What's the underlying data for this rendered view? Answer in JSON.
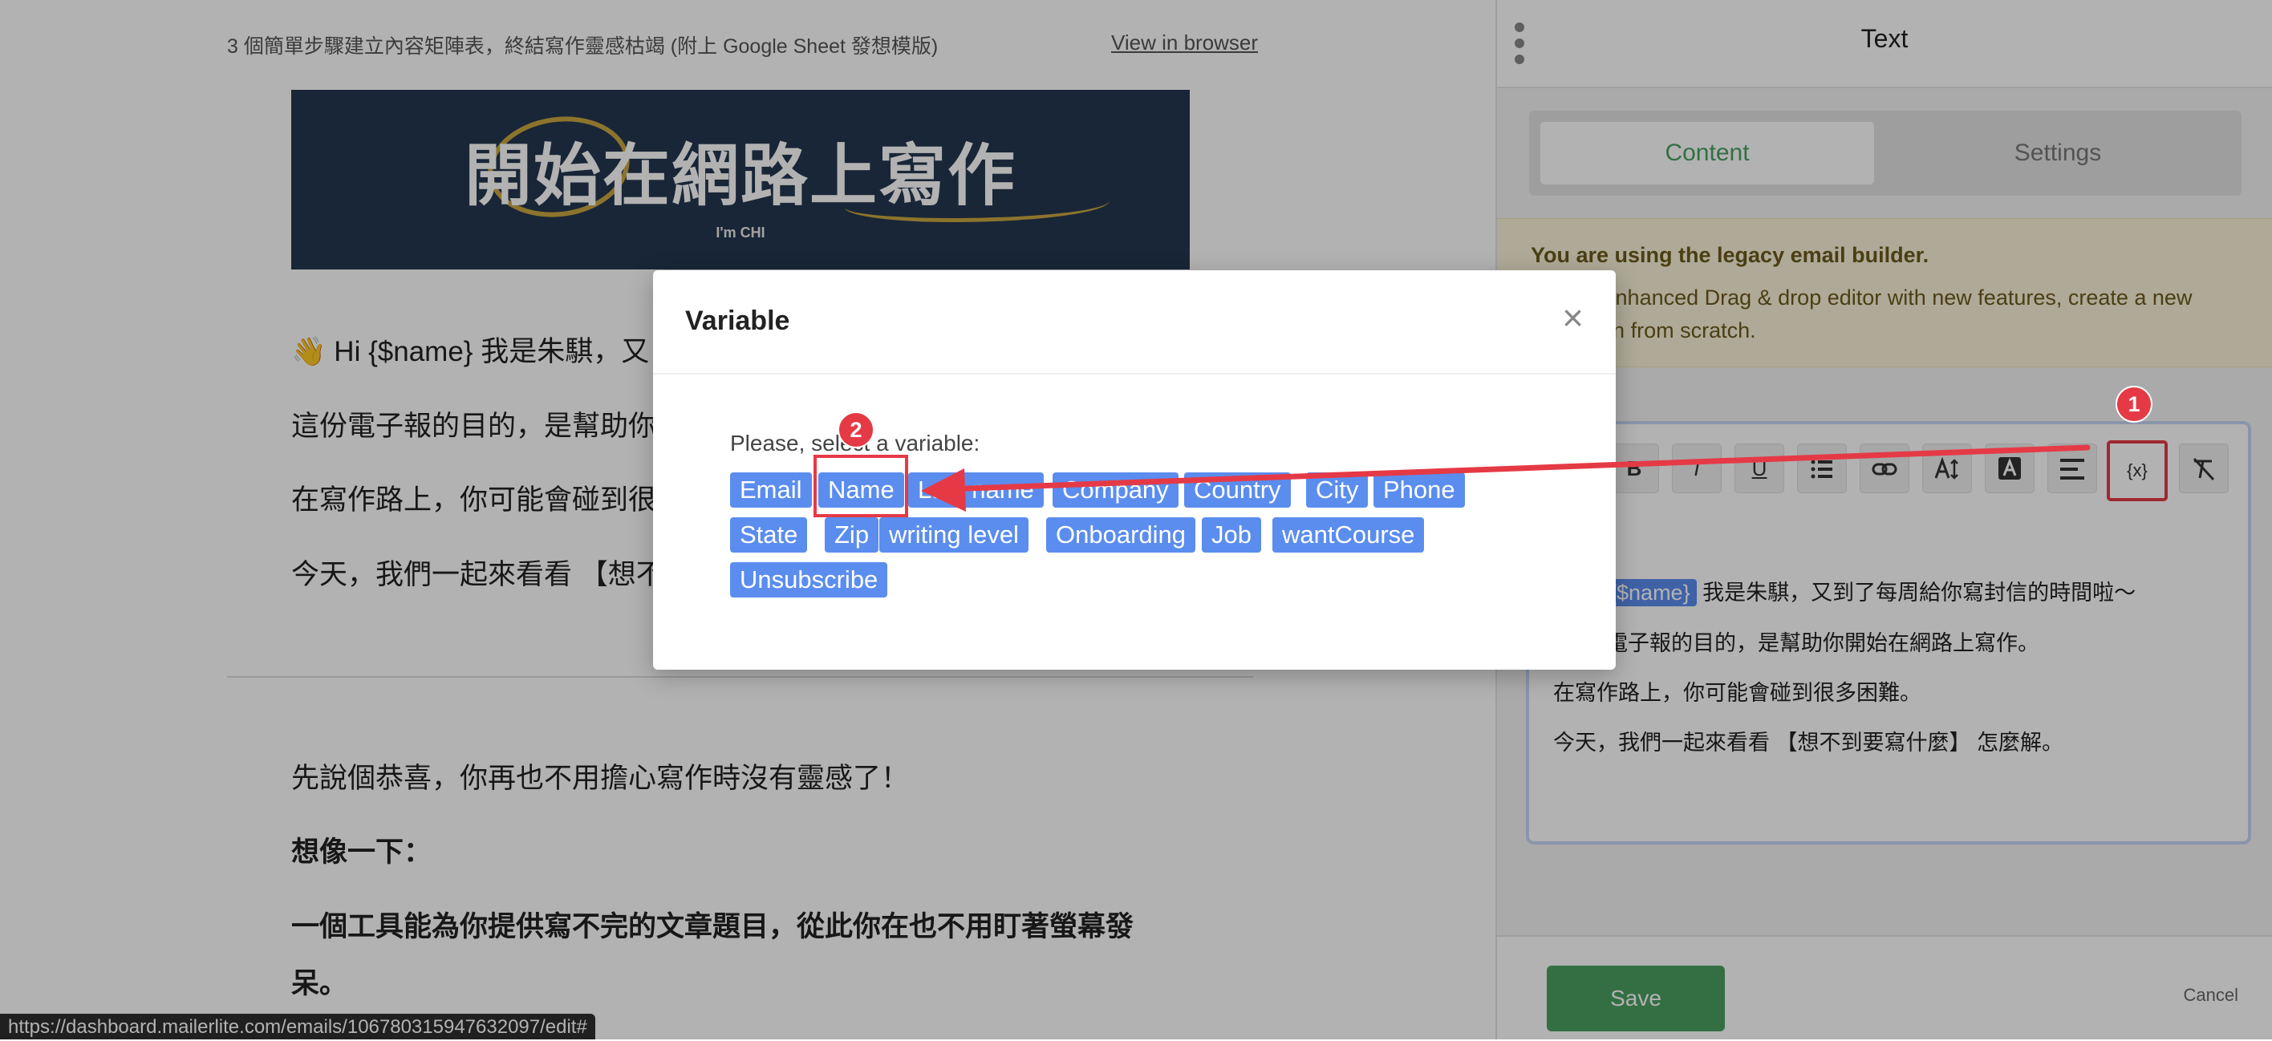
{
  "preview": {
    "subject": "3 個簡單步驟建立內容矩陣表，終結寫作靈感枯竭 (附上 Google Sheet 發想模版)",
    "view_in_browser": "View in browser",
    "banner_title": "開始在網路上寫作",
    "banner_sub": "I'm CHI",
    "line1": "👋 Hi {$name} 我是朱騏，又",
    "line2": "這份電子報的目的，是幫助你",
    "line3": "在寫作路上，你可能會碰到很",
    "line4": "今天，我們一起來看看 【想不",
    "para1": "先說個恭喜，你再也不用擔心寫作時沒有靈感了！",
    "para2": "想像一下：",
    "para3a": "一個工具能為你提供寫不完的文章題目，從此你在也不用盯著螢幕發",
    "para3b": "呆。",
    "status_url": "https://dashboard.mailerlite.com/emails/106780315947632097/edit#"
  },
  "panel": {
    "title": "Text",
    "tab_content": "Content",
    "tab_settings": "Settings",
    "legacy_title": "You are using the legacy email builder.",
    "legacy_body": "Try the enhanced Drag & drop editor with new features, create a new campaign from scratch.",
    "toolbar": {
      "bold": "B",
      "italic": "I",
      "underline": "U",
      "variable": "{x}"
    },
    "editor_var": "{$name}",
    "editor_line1": " 我是朱騏，又到了每周給你寫封信的時間啦～",
    "editor_line2": "電子報的目的，是幫助你開始在網路上寫作。",
    "editor_line3": "在寫作路上，你可能會碰到很多困難。",
    "editor_line4": "今天，我們一起來看看 【想不到要寫什麼】 怎麼解。",
    "save": "Save",
    "cancel": "Cancel"
  },
  "modal": {
    "title": "Variable",
    "close": "×",
    "prompt": "Please, select a variable:",
    "variables": [
      "Email",
      "Name",
      "Last name",
      "Company",
      "Country",
      "City",
      "Phone",
      "State",
      "Zip",
      "writing level",
      "Onboarding",
      "Job",
      "wantCourse",
      "Unsubscribe"
    ]
  },
  "annotations": {
    "badge1": "1",
    "badge2": "2"
  },
  "colors": {
    "accent_green": "#4aa061",
    "chip_blue": "#5b8def",
    "annotation_red": "#e53a46"
  },
  "icons": [
    "kebab-menu-icon",
    "list-icon",
    "link-icon",
    "text-size-icon",
    "text-color-icon",
    "align-icon",
    "variable-icon",
    "clear-format-icon",
    "close-icon"
  ]
}
